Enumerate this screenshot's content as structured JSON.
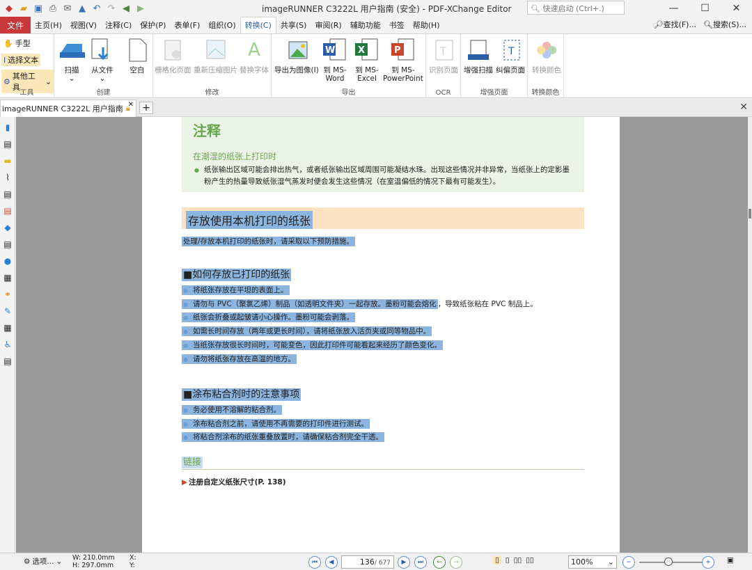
{
  "window": {
    "title": "imageRUNNER C3222L 用户指南 (安全) - PDF-XChange Editor",
    "search_placeholder": "快速启动 (Ctrl+.)"
  },
  "menu_tabs": [
    "文件",
    "主页(H)",
    "视图(V)",
    "注释(C)",
    "保护(P)",
    "表单(F)",
    "组织(O)",
    "转换(C)",
    "共享(S)",
    "审阅(R)",
    "辅助功能",
    "书签",
    "帮助(H)"
  ],
  "active_tab": "转换(C)",
  "right_tools": {
    "find": "查找(F)...",
    "search": "搜索(S)..."
  },
  "ribbon": {
    "tools": {
      "hand": "手型",
      "select_text": "选择文本",
      "other_tools": "其他工具",
      "label": "工具"
    },
    "create": {
      "scan": "扫描",
      "from_file": "从文件",
      "blank": "空白",
      "label": "创建"
    },
    "modify": {
      "rasterize": "栅格化页面",
      "recompress": "重新压缩图片",
      "replace_fonts": "替换字体",
      "label": "修改"
    },
    "export": {
      "to_image": "导出为图像(I)",
      "to_word_1": "到 MS-",
      "to_word_2": "Word",
      "to_excel_1": "到 MS-",
      "to_excel_2": "Excel",
      "to_ppt_1": "到 MS-",
      "to_ppt_2": "PowerPoint",
      "label": "导出"
    },
    "ocr": {
      "recognize": "识别页面",
      "label": "OCR"
    },
    "enhance": {
      "enhance_scan": "增强扫描",
      "deskew": "纠偏页面",
      "label": "增强页面"
    },
    "convert_colors": {
      "convert": "转换颜色",
      "label": "转换颜色"
    }
  },
  "doc_tab": {
    "name": "imageRUNNER C3222L 用户指南"
  },
  "page": {
    "note_title": "注释",
    "note_subtitle": "在潮湿的纸张上打印时",
    "note_text": "纸张输出区域可能会排出热气，或者纸张输出区域周围可能凝结水珠。出现这些情况并非异常，当纸张上的定影墨粉产生的热量导致纸张湿气蒸发时便会发生这些情况（在室温偏低的情况下最有可能发生）。",
    "section_title": "存放使用本机打印的纸张",
    "intro": "处理/存放本机打印的纸张时，请采取以下预防措施。",
    "sub1": "■如何存放已打印的纸张",
    "sub1_items": [
      "将纸张存放在平坦的表面上。",
      "请勿与 PVC（聚氯乙烯）制品（如透明文件夹）一起存放。墨粉可能会熔化",
      "纸张会折叠或起皱请小心操作。墨粉可能会剥落。",
      "如需长时间存放（两年或更长时间），请将纸张放入活页夹或同等物品中。",
      "当纸张存放很长时间时，可能变色，因此打印件可能看起来经历了颜色变化。",
      "请勿将纸张存放在高温的地方。"
    ],
    "sub1_item2_tail": "，导致纸张粘在 PVC 制品上。",
    "sub2": "■涂布粘合剂时的注意事项",
    "sub2_items": [
      "务必使用不溶解的粘合剂。",
      "涂布粘合剂之前，请使用不再需要的打印件进行测试。",
      "将粘合剂涂布的纸张重叠放置时，请确保粘合剂完全干透。"
    ],
    "link_heading": "链接",
    "link_item": "注册自定义纸张尺寸(P. 138)"
  },
  "status": {
    "options": "选项...",
    "width": "W: 210.0mm",
    "height": "H: 297.0mm",
    "x": "X:",
    "y": "Y:",
    "page_current": "136",
    "page_total": "/ 677",
    "zoom": "100%"
  },
  "colors": {
    "file_tab": "#c8373a",
    "highlight": "#8bb4de",
    "note_bg": "#ebf2e6",
    "accent_green": "#6aa64f",
    "section_bg": "#fde2c4"
  }
}
